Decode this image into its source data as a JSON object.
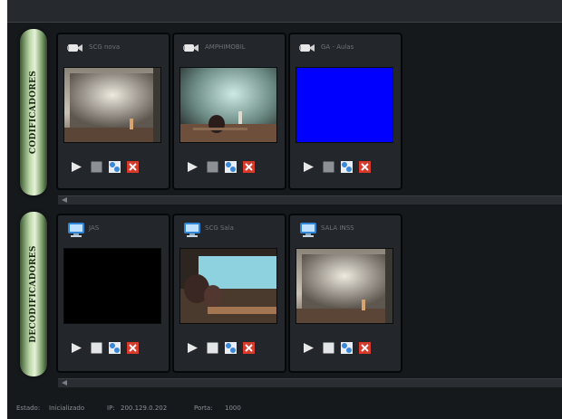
{
  "encoders_section": {
    "title": "CODIFICADORES",
    "cards": [
      {
        "label": "SCG nova",
        "preview": "stage-room"
      },
      {
        "label": "AMPHIMOBIL",
        "preview": "auditorium"
      },
      {
        "label": "GA - Aulas",
        "preview": "blue-screen"
      }
    ]
  },
  "decoders_section": {
    "title": "DECODIFICADORES",
    "cards": [
      {
        "label": "JAS",
        "preview": "black"
      },
      {
        "label": "SCG Sala",
        "preview": "classroom"
      },
      {
        "label": "SALA INSS",
        "preview": "stage-room"
      }
    ]
  },
  "status": {
    "state_label": "Estado:",
    "state_value": "Inicializado",
    "ip_label": "IP:",
    "ip_value": "200.129.0.202",
    "port_label": "Porta:",
    "port_value": "1000"
  },
  "icons": {
    "encoder_card": "camera-icon",
    "decoder_card": "monitor-icon",
    "controls": [
      "play-icon",
      "stop-icon",
      "settings-icon",
      "delete-icon"
    ]
  },
  "colors": {
    "background": "#16191c",
    "card": "#23272b",
    "side_tab": "#b9d6a6",
    "blue_preview": "#0000ff",
    "delete": "#d63b2c",
    "settings": "#3b86d8"
  }
}
